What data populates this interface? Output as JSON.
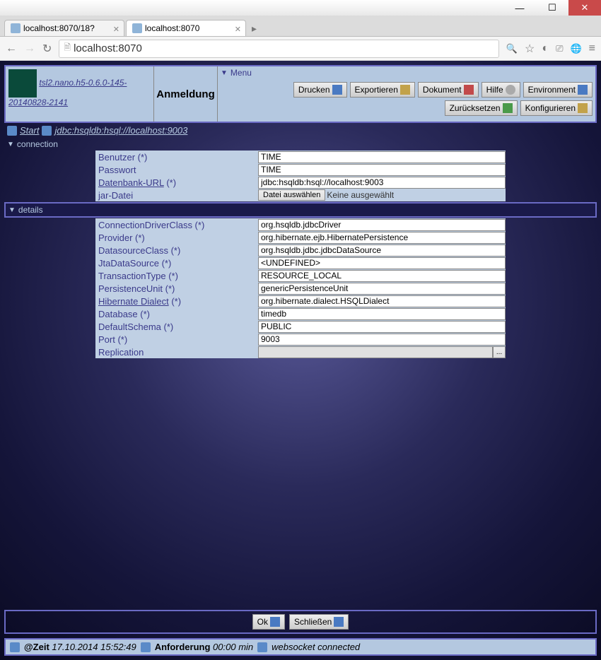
{
  "window": {
    "tabs": [
      {
        "title": "localhost:8070/18?"
      },
      {
        "title": "localhost:8070"
      }
    ],
    "url": "localhost:8070"
  },
  "header": {
    "project_link": "tsl2.nano.h5-0.6.0-145-20140828-2141",
    "title": "Anmeldung",
    "menu_label": "Menu",
    "buttons": {
      "print": "Drucken",
      "export": "Exportieren",
      "document": "Dokument",
      "help": "Hilfe",
      "environment": "Environment",
      "reset": "Zurücksetzen",
      "configure": "Konfigurieren"
    }
  },
  "breadcrumb": {
    "start": "Start",
    "path": "jdbc:hsqldb:hsql://localhost:9003"
  },
  "sections": {
    "connection": "connection",
    "details": "details"
  },
  "connection": {
    "user_label": "Benutzer (*)",
    "user_value": "TIME",
    "pass_label": "Passwort",
    "pass_value": "TIME",
    "dburl_label": "Datenbank-URL",
    "dburl_req": " (*)",
    "dburl_value": "jdbc:hsqldb:hsql://localhost:9003",
    "jar_label": "jar-Datei",
    "file_button": "Datei auswählen",
    "file_status": "Keine ausgewählt"
  },
  "details": {
    "rows": [
      {
        "label": "ConnectionDriverClass (*)",
        "value": "org.hsqldb.jdbcDriver"
      },
      {
        "label": "Provider (*)",
        "value": "org.hibernate.ejb.HibernatePersistence"
      },
      {
        "label": "DatasourceClass (*)",
        "value": "org.hsqldb.jdbc.jdbcDataSource"
      },
      {
        "label": "JtaDataSource (*)",
        "value": "<UNDEFINED>"
      },
      {
        "label": "TransactionType (*)",
        "value": "RESOURCE_LOCAL"
      },
      {
        "label": "PersistenceUnit (*)",
        "value": "genericPersistenceUnit"
      },
      {
        "label": "Hibernate Dialect",
        "link": true,
        "req": " (*)",
        "value": "org.hibernate.dialect.HSQLDialect"
      },
      {
        "label": "Database (*)",
        "value": "timedb"
      },
      {
        "label": "DefaultSchema (*)",
        "value": "PUBLIC"
      },
      {
        "label": "Port (*)",
        "value": "9003"
      }
    ],
    "replication_label": "Replication",
    "replication_btn": "..."
  },
  "bottom": {
    "ok": "Ok",
    "close": "Schließen"
  },
  "status": {
    "time_label": "@Zeit",
    "time_value": "17.10.2014 15:52:49",
    "req_label": "Anforderung",
    "req_value": "00:00 min",
    "ws": "websocket connected"
  }
}
